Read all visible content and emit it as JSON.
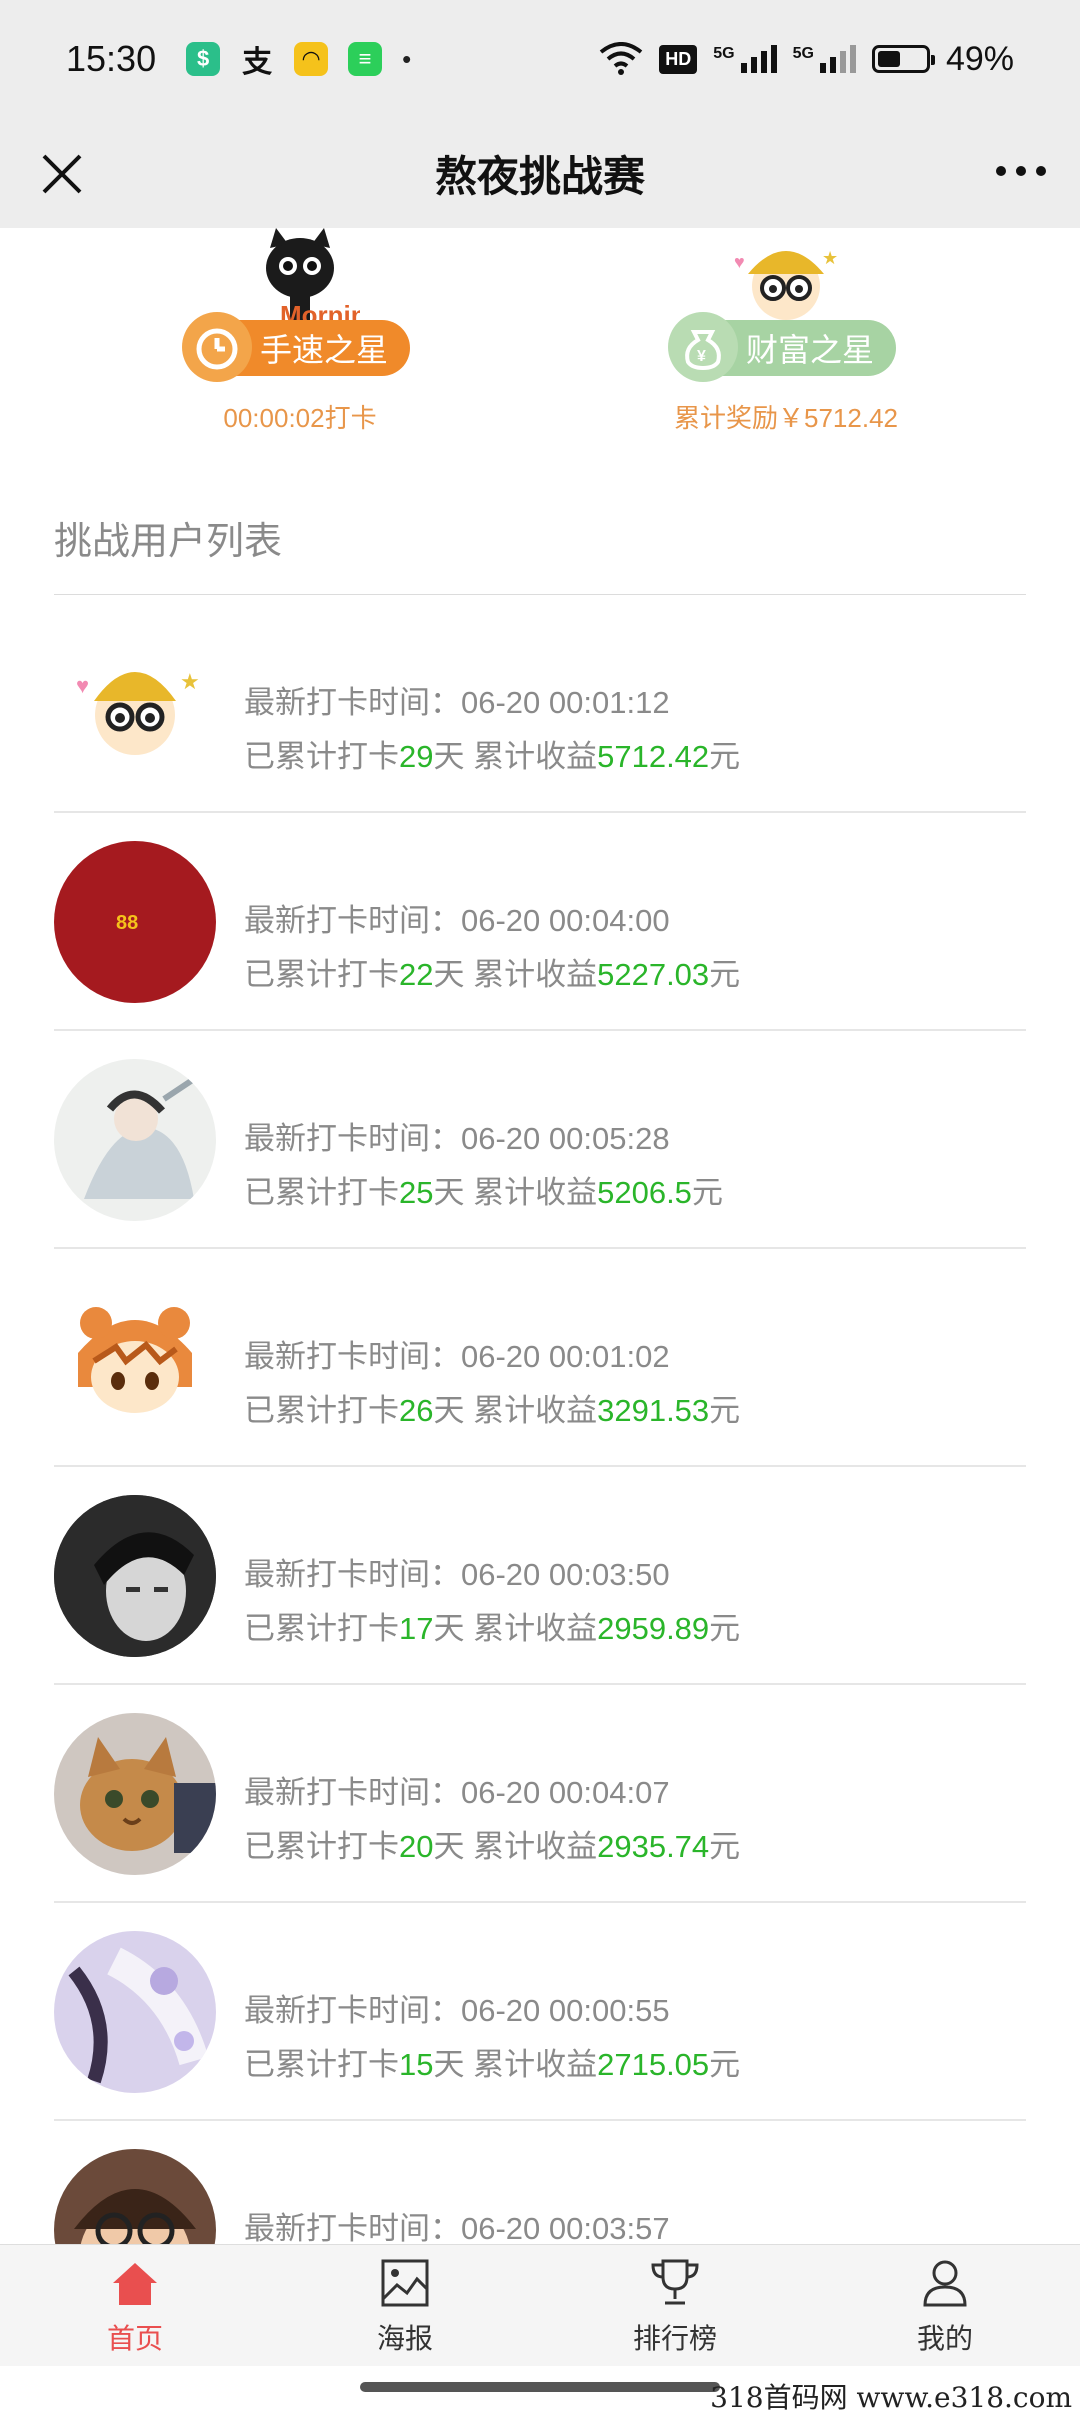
{
  "status_bar": {
    "time": "15:30",
    "app_icons": [
      "shield-app-icon",
      "alipay-icon",
      "smiley-app-icon",
      "chat-bubble-app-icon"
    ],
    "dot": "•",
    "hd": "HD",
    "signal_1_label": "5G",
    "signal_2_label": "5G",
    "battery_level": 0.49,
    "battery_text": "49%"
  },
  "nav": {
    "title": "熬夜挑战赛",
    "close_icon": "close-icon",
    "more_icon": "more-dots-icon"
  },
  "stars": [
    {
      "badge": "手速之星",
      "caption": "00:00:02打卡",
      "color": "#f08a2a",
      "icon": "clock-icon"
    },
    {
      "badge": "财富之星",
      "caption": "累计奖励￥5712.42",
      "color": "#a7d3a3",
      "icon": "money-bag-icon"
    }
  ],
  "section_title": "挑战用户列表",
  "list_labels": {
    "time_prefix": "最新打卡时间：",
    "days_prefix": "已累计打卡",
    "days_suffix": "天 累计收益",
    "money_suffix": "元"
  },
  "users": [
    {
      "time": "06-20 00:01:12",
      "days": "29",
      "earnings": "5712.42"
    },
    {
      "time": "06-20 00:04:00",
      "days": "22",
      "earnings": "5227.03"
    },
    {
      "time": "06-20 00:05:28",
      "days": "25",
      "earnings": "5206.5"
    },
    {
      "time": "06-20 00:01:02",
      "days": "26",
      "earnings": "3291.53"
    },
    {
      "time": "06-20 00:03:50",
      "days": "17",
      "earnings": "2959.89"
    },
    {
      "time": "06-20 00:04:07",
      "days": "20",
      "earnings": "2935.74"
    },
    {
      "time": "06-20 00:00:55",
      "days": "15",
      "earnings": "2715.05"
    },
    {
      "time": "06-20 00:03:57",
      "days": "",
      "earnings": ""
    }
  ],
  "tabs": [
    {
      "label": "首页",
      "icon": "home-icon",
      "active": true
    },
    {
      "label": "海报",
      "icon": "poster-icon",
      "active": false
    },
    {
      "label": "排行榜",
      "icon": "trophy-icon",
      "active": false
    },
    {
      "label": "我的",
      "icon": "profile-icon",
      "active": false
    }
  ],
  "watermark": "318首码网 www.e318.com",
  "colors": {
    "accent_red": "#e94f4f",
    "green": "#2ab52a",
    "orange": "#f08a2a",
    "caption": "#e8964a"
  }
}
